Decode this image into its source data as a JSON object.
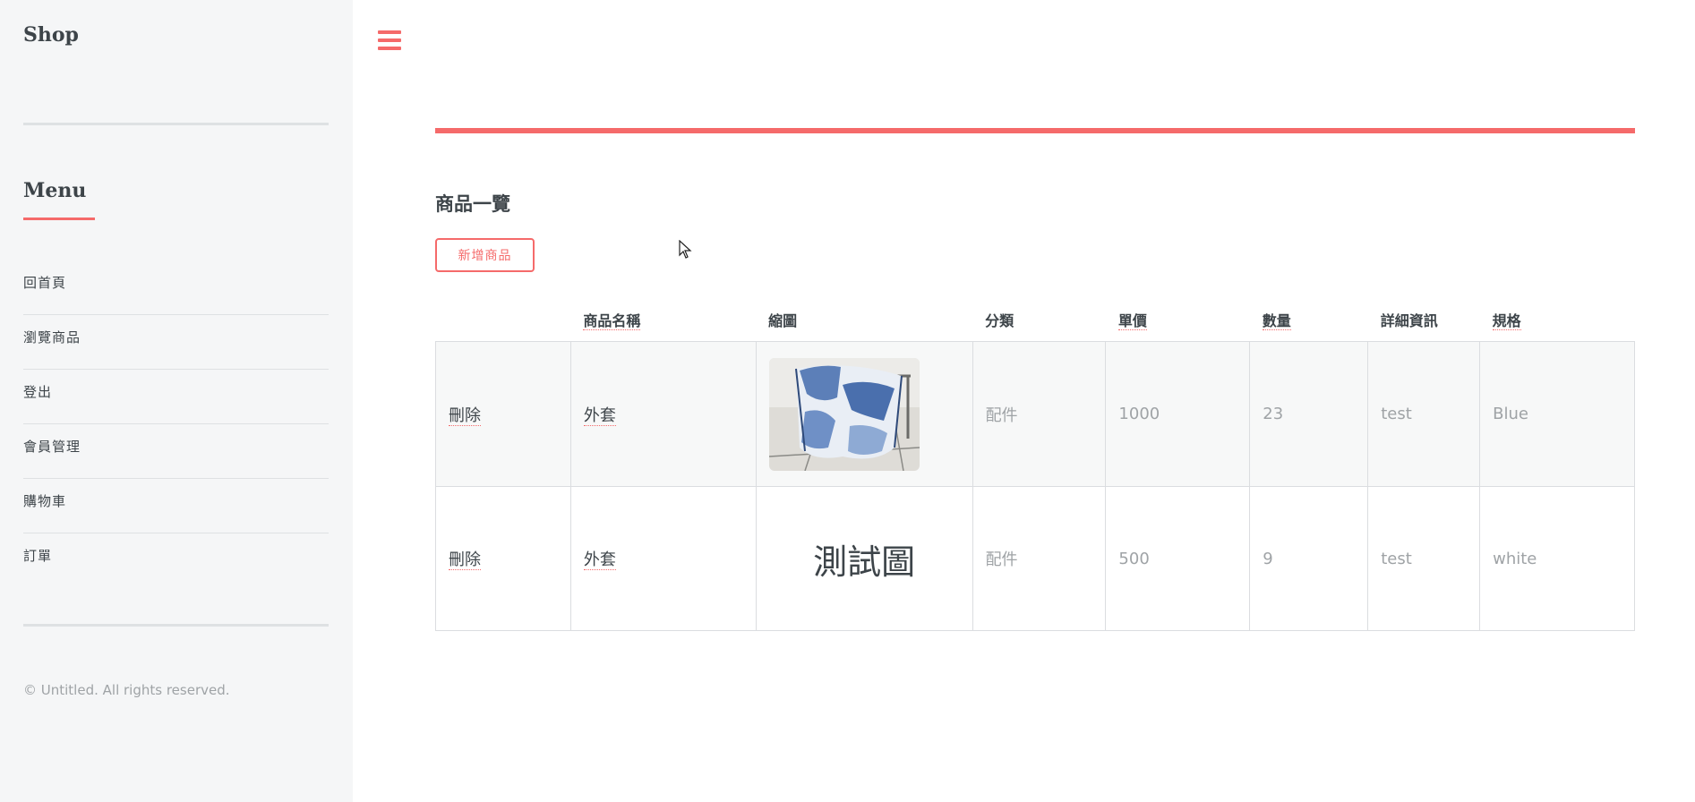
{
  "sidebar": {
    "brand": "Shop",
    "menu_heading": "Menu",
    "items": [
      {
        "label": "回首頁"
      },
      {
        "label": "瀏覽商品"
      },
      {
        "label": "登出"
      },
      {
        "label": "會員管理"
      },
      {
        "label": "購物車"
      },
      {
        "label": "訂單"
      }
    ],
    "copyright": "© Untitled. All rights reserved."
  },
  "header": {
    "menu_icon": "hamburger-icon"
  },
  "main": {
    "title": "商品一覽",
    "add_button": "新增商品",
    "table": {
      "headers": [
        "",
        "商品名稱",
        "縮圖",
        "分類",
        "單價",
        "數量",
        "詳細資訊",
        "規格"
      ],
      "rows": [
        {
          "action": "刪除",
          "name": "外套",
          "thumbnail": "image",
          "category": "配件",
          "price": "1000",
          "quantity": "23",
          "detail": "test",
          "spec": "Blue"
        },
        {
          "action": "刪除",
          "name": "外套",
          "thumbnail": "測試圖",
          "category": "配件",
          "price": "500",
          "quantity": "9",
          "detail": "test",
          "spec": "white"
        }
      ]
    }
  },
  "colors": {
    "accent": "#f56a6a",
    "text": "#3d4449",
    "muted": "#9fa3a6",
    "sidebar_bg": "#f5f6f7"
  }
}
